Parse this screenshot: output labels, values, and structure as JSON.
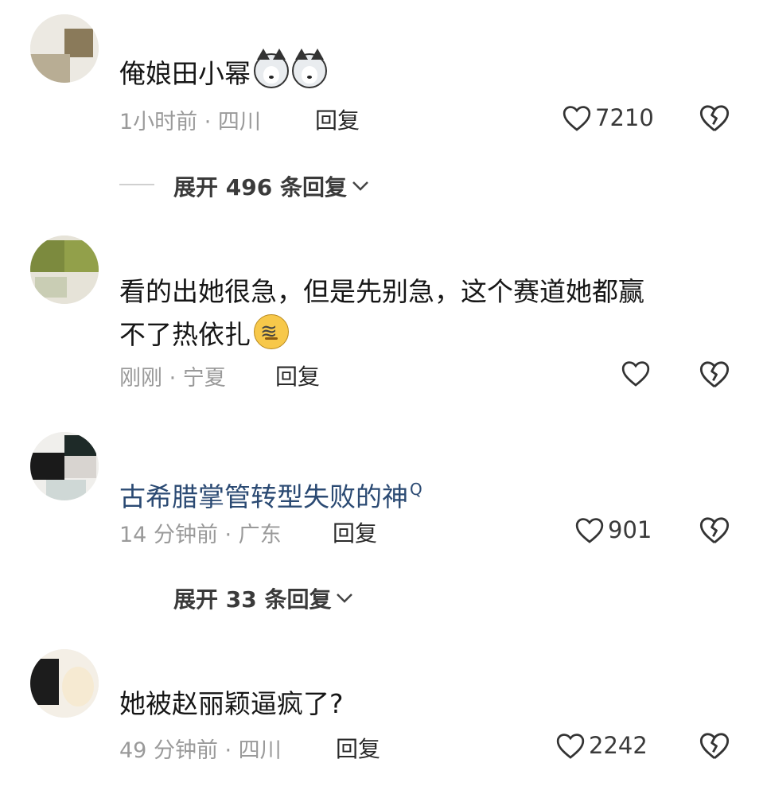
{
  "comments": [
    {
      "username": "",
      "text": "俺娘田小幂",
      "emojis": [
        "husky-cat-emoji",
        "husky-cat-emoji"
      ],
      "meta": "1小时前 · 四川",
      "reply_label": "回复",
      "likes": "7210",
      "expand_label": "展开 496 条回复"
    },
    {
      "username": "",
      "text_line1": "看的出她很急，但是先别急，这个赛道她都赢",
      "text_line2": "不了热依扎",
      "emojis": [
        "dizzy-face-emoji"
      ],
      "meta": "刚刚 · 宁夏",
      "reply_label": "回复",
      "likes": ""
    },
    {
      "text": "古希腊掌管转型失败的神",
      "search_mark": "Q",
      "meta": "14 分钟前 · 广东",
      "reply_label": "回复",
      "likes": "901",
      "expand_label": "展开 33 条回复"
    },
    {
      "username": "",
      "text": "她被赵丽颖逼疯了?",
      "meta": "49 分钟前 · 四川",
      "reply_label": "回复",
      "likes": "2242"
    }
  ],
  "icons": {
    "like": "heart-outline-icon",
    "dislike": "broken-heart-icon",
    "expand": "chevron-down-icon"
  },
  "colors": {
    "text": "#161616",
    "link_text": "#2b4a73",
    "meta": "#9a9a9a"
  }
}
